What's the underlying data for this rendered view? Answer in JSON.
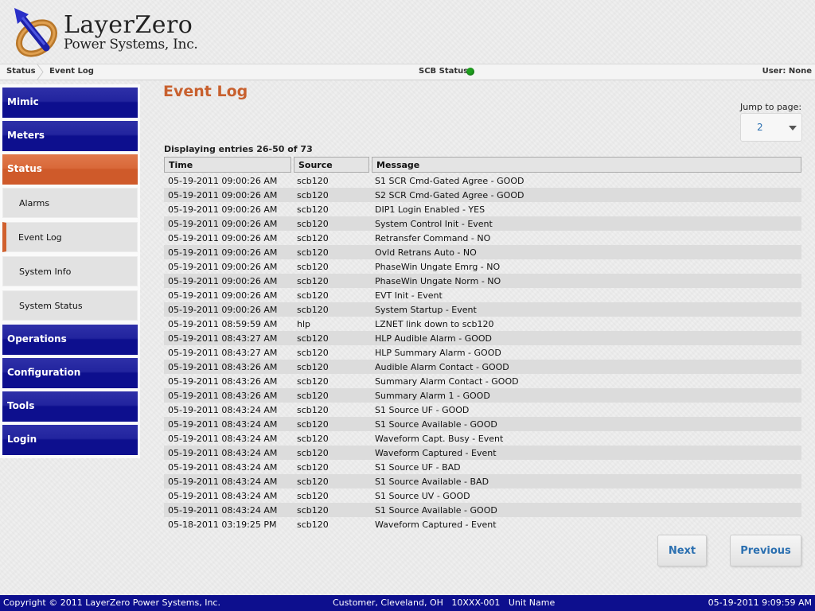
{
  "brand": {
    "line1": "LayerZero",
    "line2": "Power Systems, Inc."
  },
  "statusbar": {
    "crumb1": "Status",
    "crumb2": "Event Log",
    "scb_label": "SCB Status:",
    "scb_color": "#1ea01e",
    "user": "User: None"
  },
  "sidebar": {
    "mimic": "Mimic",
    "meters": "Meters",
    "status": "Status",
    "alarms": "Alarms",
    "event_log": "Event Log",
    "system_info": "System Info",
    "system_status": "System Status",
    "operations": "Operations",
    "configuration": "Configuration",
    "tools": "Tools",
    "login": "Login"
  },
  "main": {
    "title": "Event Log",
    "jump_label": "Jump to page:",
    "jump_value": "2",
    "displaying": "Displaying entries 26-50 of 73",
    "columns": [
      "Time",
      "Source",
      "Message"
    ],
    "rows": [
      [
        "05-19-2011 09:00:26 AM",
        "scb120",
        "S1 SCR Cmd-Gated Agree - GOOD"
      ],
      [
        "05-19-2011 09:00:26 AM",
        "scb120",
        "S2 SCR Cmd-Gated Agree - GOOD"
      ],
      [
        "05-19-2011 09:00:26 AM",
        "scb120",
        "DIP1 Login Enabled - YES"
      ],
      [
        "05-19-2011 09:00:26 AM",
        "scb120",
        "System Control Init - Event"
      ],
      [
        "05-19-2011 09:00:26 AM",
        "scb120",
        "Retransfer Command - NO"
      ],
      [
        "05-19-2011 09:00:26 AM",
        "scb120",
        "Ovld Retrans Auto - NO"
      ],
      [
        "05-19-2011 09:00:26 AM",
        "scb120",
        "PhaseWin Ungate Emrg - NO"
      ],
      [
        "05-19-2011 09:00:26 AM",
        "scb120",
        "PhaseWin Ungate Norm - NO"
      ],
      [
        "05-19-2011 09:00:26 AM",
        "scb120",
        "EVT Init - Event"
      ],
      [
        "05-19-2011 09:00:26 AM",
        "scb120",
        "System Startup - Event"
      ],
      [
        "05-19-2011 08:59:59 AM",
        "hlp",
        "LZNET link down to scb120"
      ],
      [
        "05-19-2011 08:43:27 AM",
        "scb120",
        "HLP Audible Alarm - GOOD"
      ],
      [
        "05-19-2011 08:43:27 AM",
        "scb120",
        "HLP Summary Alarm - GOOD"
      ],
      [
        "05-19-2011 08:43:26 AM",
        "scb120",
        "Audible Alarm Contact - GOOD"
      ],
      [
        "05-19-2011 08:43:26 AM",
        "scb120",
        "Summary Alarm Contact - GOOD"
      ],
      [
        "05-19-2011 08:43:26 AM",
        "scb120",
        "Summary Alarm 1 - GOOD"
      ],
      [
        "05-19-2011 08:43:24 AM",
        "scb120",
        "S1 Source UF - GOOD"
      ],
      [
        "05-19-2011 08:43:24 AM",
        "scb120",
        "S1 Source Available - GOOD"
      ],
      [
        "05-19-2011 08:43:24 AM",
        "scb120",
        "Waveform Capt. Busy - Event"
      ],
      [
        "05-19-2011 08:43:24 AM",
        "scb120",
        "Waveform Captured - Event"
      ],
      [
        "05-19-2011 08:43:24 AM",
        "scb120",
        "S1 Source UF - BAD"
      ],
      [
        "05-19-2011 08:43:24 AM",
        "scb120",
        "S1 Source Available - BAD"
      ],
      [
        "05-19-2011 08:43:24 AM",
        "scb120",
        "S1 Source UV - GOOD"
      ],
      [
        "05-19-2011 08:43:24 AM",
        "scb120",
        "S1 Source Available - GOOD"
      ],
      [
        "05-18-2011 03:19:25 PM",
        "scb120",
        "Waveform Captured - Event"
      ]
    ],
    "next": "Next",
    "previous": "Previous"
  },
  "footer": {
    "copyright": "Copyright © 2011 LayerZero Power Systems, Inc.",
    "location": "Customer, Cleveland, OH   10XXX-001   Unit Name",
    "datetime": "05-19-2011 9:09:59 AM"
  },
  "colors": {
    "nav_blue": "#0d0f8e",
    "nav_active": "#cf5a2a",
    "title": "#c8602e",
    "link": "#2a6fb0"
  }
}
